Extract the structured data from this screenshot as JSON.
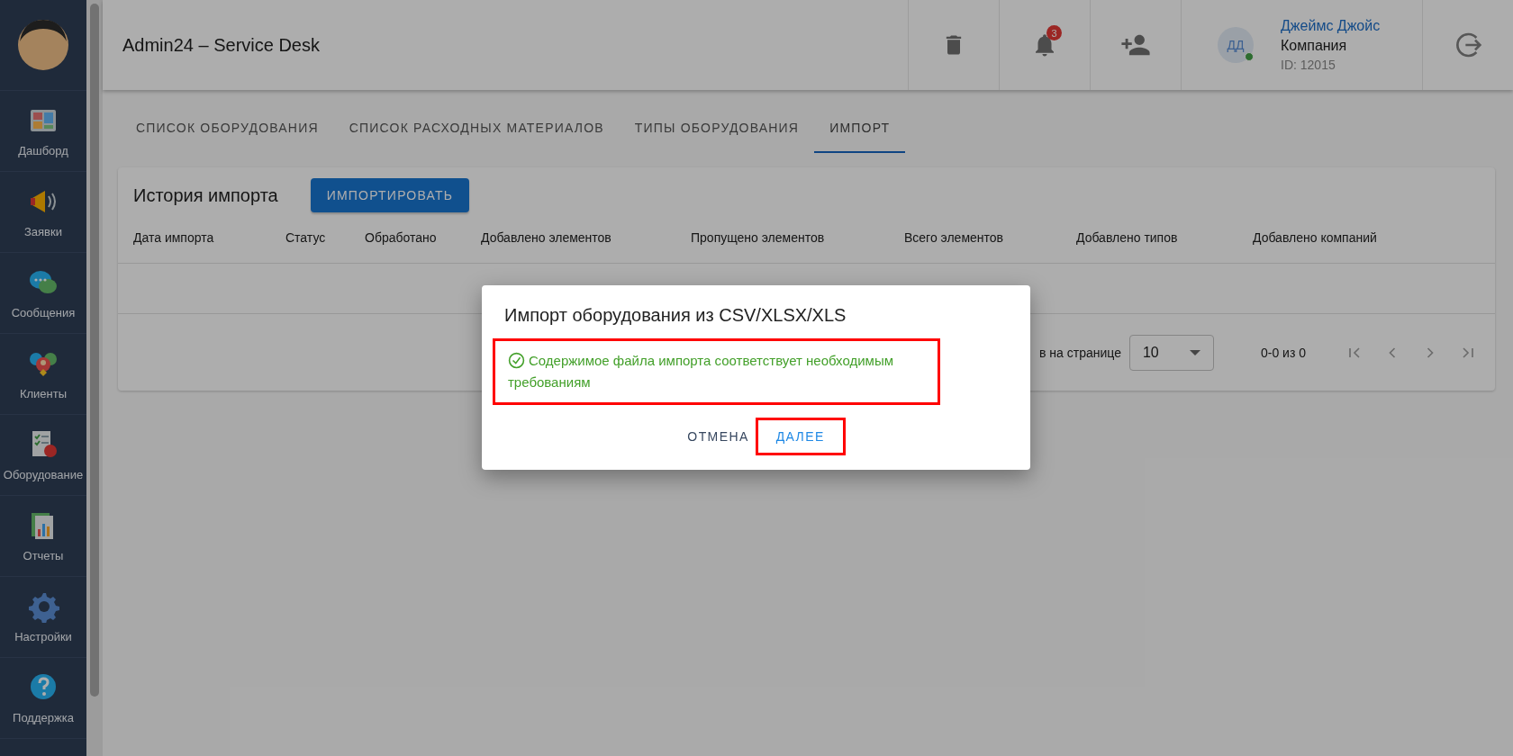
{
  "sidebar": {
    "items": [
      {
        "label": "Дашборд"
      },
      {
        "label": "Заявки"
      },
      {
        "label": "Сообщения"
      },
      {
        "label": "Клиенты"
      },
      {
        "label": "Оборудование"
      },
      {
        "label": "Отчеты"
      },
      {
        "label": "Настройки"
      },
      {
        "label": "Поддержка"
      }
    ]
  },
  "header": {
    "title": "Admin24 – Service Desk",
    "notifications": "3",
    "user": {
      "initials": "ДД",
      "online": true,
      "name": "Джеймс Джойс",
      "company": "Компания",
      "id": "ID: 12015"
    }
  },
  "tabs": [
    {
      "label": "СПИСОК ОБОРУДОВАНИЯ",
      "selected": false
    },
    {
      "label": "СПИСОК РАСХОДНЫХ МАТЕРИАЛОВ",
      "selected": false
    },
    {
      "label": "ТИПЫ ОБОРУДОВАНИЯ",
      "selected": false
    },
    {
      "label": "ИМПОРТ",
      "selected": true
    }
  ],
  "card": {
    "title": "История импорта",
    "import_button": "ИМПОРТИРОВАТЬ",
    "table": {
      "columns": [
        "Дата импорта",
        "Статус",
        "Обработано",
        "Добавлено элементов",
        "Пропущено элементов",
        "Всего элементов",
        "Добавлено типов",
        "Добавлено компаний"
      ]
    },
    "pagination": {
      "rows_per_page_label": "в на странице",
      "rows_per_page": "10",
      "range": "0-0 из 0"
    }
  },
  "dialog": {
    "title": "Импорт оборудования из CSV/XLSX/XLS",
    "message": "Содержимое файла импорта соответствует необходимым требованиям",
    "message_highlighted": true,
    "buttons": [
      {
        "label": "ОТМЕНА",
        "kind": "cancel",
        "highlighted": false
      },
      {
        "label": "ДАЛЕЕ",
        "kind": "primary",
        "highlighted": true
      }
    ]
  }
}
